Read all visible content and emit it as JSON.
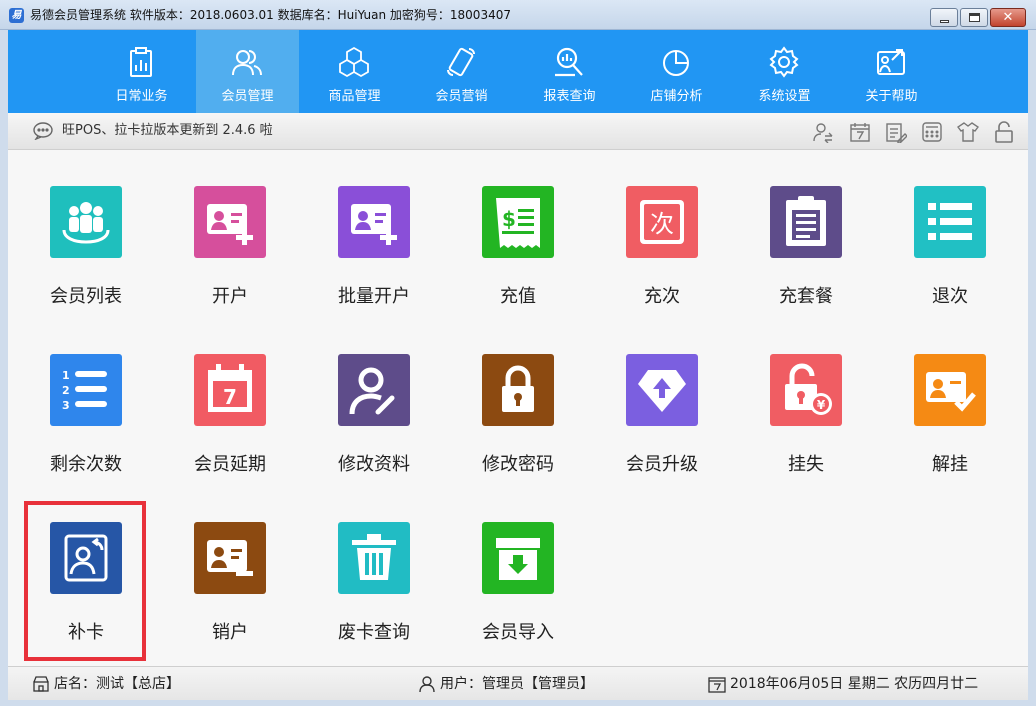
{
  "titlebar": {
    "text": "易德会员管理系统   软件版本：2018.0603.01   数据库名：HuiYuan   加密狗号：18003407"
  },
  "nav": {
    "items": [
      {
        "label": "日常业务",
        "icon": "clipboard-chart-icon"
      },
      {
        "label": "会员管理",
        "icon": "users-icon"
      },
      {
        "label": "商品管理",
        "icon": "cubes-icon"
      },
      {
        "label": "会员营销",
        "icon": "phone-icon"
      },
      {
        "label": "报表查询",
        "icon": "search-report-icon"
      },
      {
        "label": "店铺分析",
        "icon": "pie-chart-icon"
      },
      {
        "label": "系统设置",
        "icon": "gear-icon"
      },
      {
        "label": "关于帮助",
        "icon": "help-icon"
      }
    ],
    "active": "会员管理"
  },
  "notice": {
    "text": "旺POS、拉卡拉版本更新到 2.4.6 啦"
  },
  "tiles": [
    {
      "label": "会员列表",
      "color": "#1fbfbd",
      "icon": "member-list-icon"
    },
    {
      "label": "开户",
      "color": "#d64f9c",
      "icon": "open-account-icon"
    },
    {
      "label": "批量开户",
      "color": "#8a4fd8",
      "icon": "batch-open-account-icon"
    },
    {
      "label": "充值",
      "color": "#23b523",
      "icon": "recharge-icon"
    },
    {
      "label": "充次",
      "color": "#f05d63",
      "icon": "recharge-times-icon"
    },
    {
      "label": "充套餐",
      "color": "#5e4c8a",
      "icon": "package-icon"
    },
    {
      "label": "退次",
      "color": "#21c0c4",
      "icon": "return-times-icon"
    },
    {
      "label": "剩余次数",
      "color": "#2f86ec",
      "icon": "remaining-times-icon"
    },
    {
      "label": "会员延期",
      "color": "#f15b63",
      "icon": "calendar-extend-icon"
    },
    {
      "label": "修改资料",
      "color": "#5e4c8a",
      "icon": "edit-profile-icon"
    },
    {
      "label": "修改密码",
      "color": "#8c4a11",
      "icon": "lock-icon"
    },
    {
      "label": "会员升级",
      "color": "#7b5fe0",
      "icon": "upgrade-icon"
    },
    {
      "label": "挂失",
      "color": "#f05d63",
      "icon": "report-loss-icon"
    },
    {
      "label": "解挂",
      "color": "#f58a14",
      "icon": "unlock-card-icon"
    },
    {
      "label": "补卡",
      "color": "#2656a6",
      "icon": "reissue-card-icon"
    },
    {
      "label": "销户",
      "color": "#8c4a11",
      "icon": "close-account-icon"
    },
    {
      "label": "废卡查询",
      "color": "#21bcc4",
      "icon": "trash-icon"
    },
    {
      "label": "会员导入",
      "color": "#23b523",
      "icon": "import-icon"
    }
  ],
  "status": {
    "store": "店名：测试【总店】",
    "user": "用户：管理员【管理员】",
    "date": "2018年06月05日 星期二 农历四月廿二"
  }
}
